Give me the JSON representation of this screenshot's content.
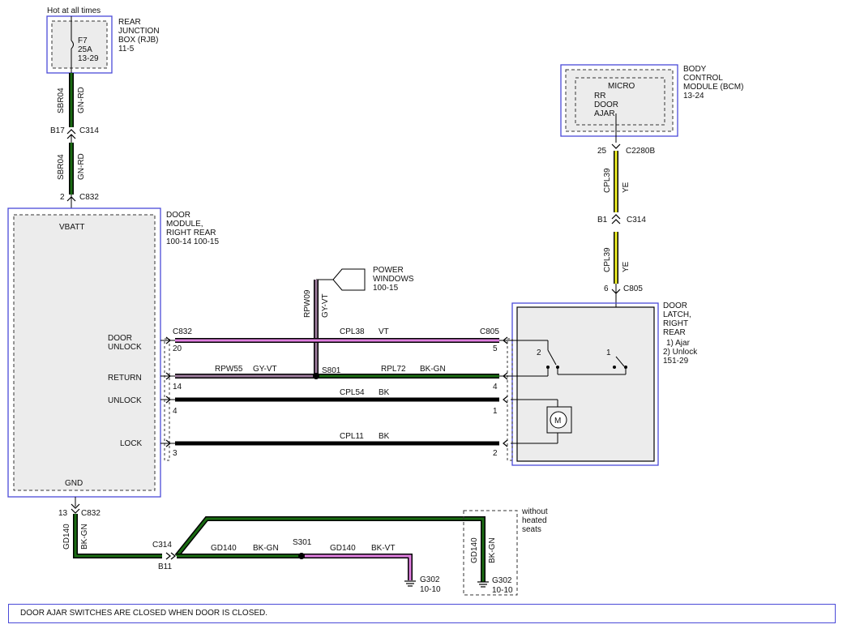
{
  "rjb": {
    "hot": "Hot at all times",
    "fuse": "F7",
    "amp": "25A",
    "ref": "13-29",
    "name1": "REAR",
    "name2": "JUNCTION",
    "name3": "BOX (RJB)",
    "page": "11-5"
  },
  "bcm": {
    "name1": "BODY",
    "name2": "CONTROL",
    "name3": "MODULE (BCM)",
    "page": "13-24",
    "micro": "MICRO",
    "rr": "RR",
    "door": "DOOR",
    "ajar": "AJAR"
  },
  "dm": {
    "name1": "DOOR",
    "name2": "MODULE,",
    "name3": "RIGHT REAR",
    "pages": "100-14   100-15",
    "vbatt": "VBATT",
    "gnd": "GND",
    "door": "DOOR",
    "unlock_pin": "UNLOCK",
    "return": "RETURN",
    "unlock": "UNLOCK",
    "lock": "LOCK"
  },
  "latch": {
    "name1": "DOOR",
    "name2": "LATCH,",
    "name3": "RIGHT",
    "name4": "REAR",
    "opt1": "1) Ajar",
    "opt2": "2) Unlock",
    "page": "151-29",
    "sw2": "2",
    "sw1": "1",
    "motor": "M"
  },
  "pw": {
    "name1": "POWER",
    "name2": "WINDOWS",
    "page": "100-15"
  },
  "wires": {
    "sbr04": "SBR04",
    "gnrd": "GN-RD",
    "b17": "B17",
    "c314": "C314",
    "pin2": "2",
    "c832": "C832",
    "pin25": "25",
    "c2280b": "C2280B",
    "cpl39": "CPL39",
    "ye": "YE",
    "b1": "B1",
    "pin6": "6",
    "c805": "C805",
    "rpw09": "RPW09",
    "gyvt": "GY-VT",
    "cpl38": "CPL38",
    "vt": "VT",
    "p20": "20",
    "p5": "5",
    "rpw55": "RPW55",
    "s801": "S801",
    "rpl72": "RPL72",
    "bkgn": "BK-GN",
    "p14": "14",
    "p4": "4",
    "cpl54": "CPL54",
    "bk": "BK",
    "p4b": "4",
    "p1": "1",
    "cpl11": "CPL11",
    "p3": "3",
    "p2": "2",
    "p13": "13",
    "gd140": "GD140",
    "b11": "B11",
    "s301": "S301",
    "bkvt": "BK-VT",
    "g302": "G302",
    "g302ref": "10-10",
    "noheat1": "without",
    "noheat2": "heated",
    "noheat3": "seats"
  },
  "note": "DOOR AJAR SWITCHES ARE CLOSED WHEN DOOR IS CLOSED.",
  "colors": {
    "green": "#1a6b12",
    "yellow": "#f2f226",
    "violet": "#e080e0",
    "grayviolet": "#9a7a9a",
    "black": "#000000",
    "border": "#4a4ad8"
  }
}
